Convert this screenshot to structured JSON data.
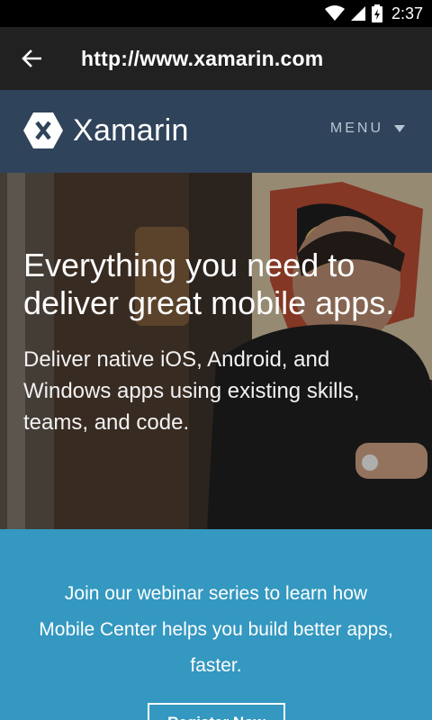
{
  "status_bar": {
    "time": "2:37",
    "icons": [
      "wifi-icon",
      "signal-icon",
      "battery-icon"
    ]
  },
  "app_bar": {
    "back_icon": "arrow-left-icon",
    "url": "http://www.xamarin.com"
  },
  "site_header": {
    "logo_text": "Xamarin",
    "menu_label": "MENU",
    "menu_icon": "caret-down-icon"
  },
  "hero": {
    "headline": "Everything you need to deliver great mobile apps.",
    "subtext": "Deliver native iOS, Android, and Windows apps using existing skills, teams, and code."
  },
  "promo": {
    "text": "Join our webinar series to learn how Mobile Center helps you build better apps, faster.",
    "button_label": "Register Now"
  },
  "colors": {
    "status_bar": "#000000",
    "app_bar": "#212121",
    "header": "#2f435a",
    "promo": "#3498c0"
  }
}
